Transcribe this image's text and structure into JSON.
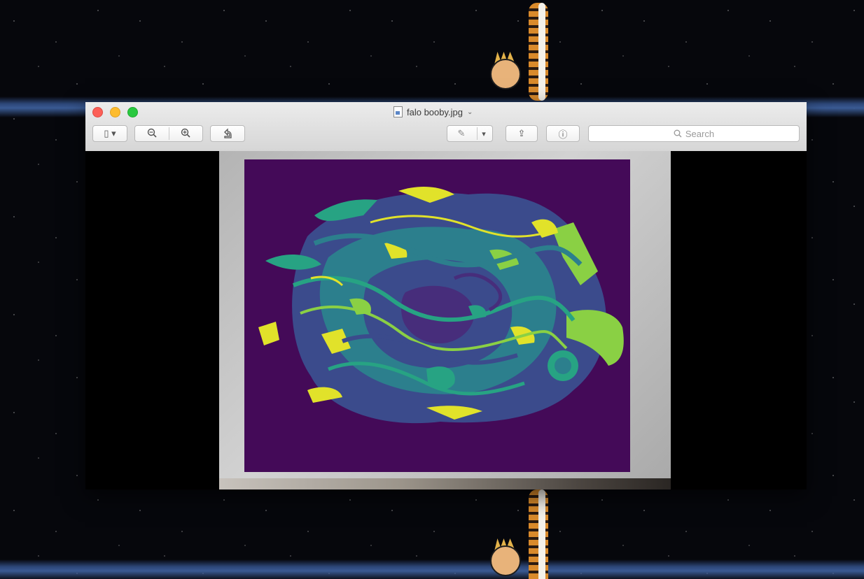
{
  "window": {
    "title": "falo booby.jpg",
    "title_chevron": "⌄"
  },
  "toolbar": {
    "sidebar_button": "▯ ▾",
    "zoom_out_button": "−",
    "zoom_in_button": "+",
    "rotate_button": "↶",
    "markup_button": "✎",
    "markup_menu": "▾",
    "share_button": "⇪",
    "info_button": "ⓘ",
    "search": {
      "placeholder": "Search",
      "value": ""
    }
  },
  "colors": {
    "plot_background": "#440a58",
    "palette": [
      "#3b4b8c",
      "#2c7f8d",
      "#27a383",
      "#8ad044",
      "#e1e22a"
    ]
  }
}
